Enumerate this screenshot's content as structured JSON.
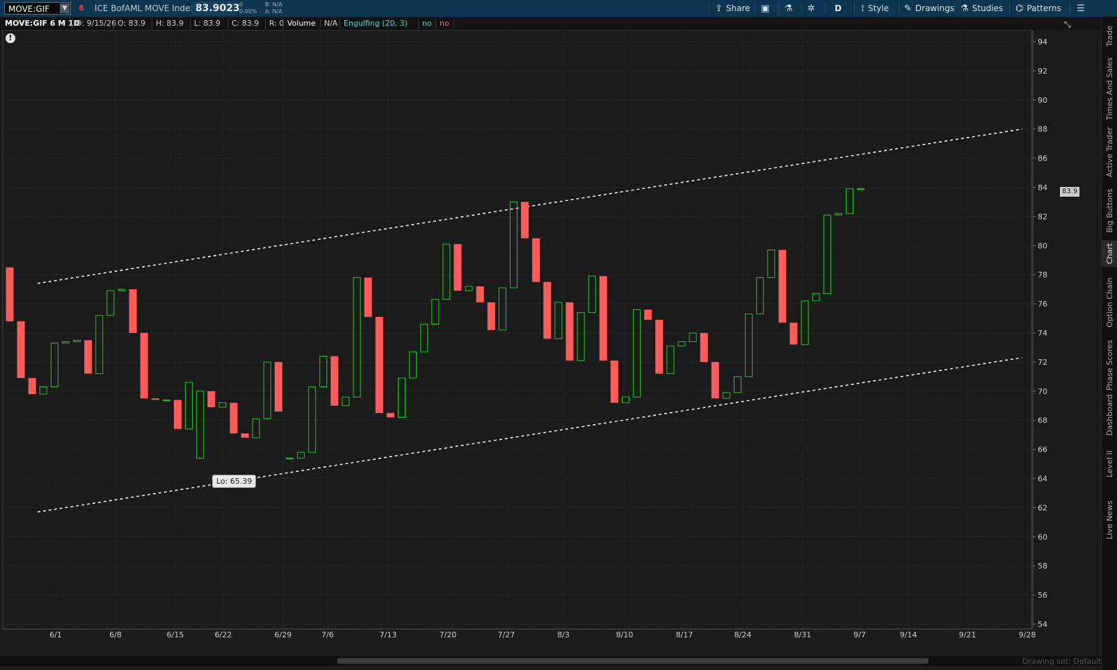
{
  "header": {
    "symbol": "MOVE:GIF",
    "link_flag": "8",
    "instrument_name": "ICE BofAML MOVE Index",
    "last_price": "83.9023",
    "change": "0",
    "change_pct": "0.00%",
    "bid": "B: N/A",
    "ask": "A: N/A"
  },
  "toolbar": {
    "share": "Share",
    "aggregation": "D",
    "style": "Style",
    "drawings": "Drawings",
    "studies": "Studies",
    "patterns": "Patterns"
  },
  "infobar": {
    "title": "MOVE:GIF 6 M 1D",
    "date": "D: 9/15/26",
    "open": "O: 83.9",
    "high": "H: 83.9",
    "low": "L: 83.9",
    "close": "C: 83.9",
    "range": "R: 0",
    "volume_label": "Volume",
    "volume_value": "N/A",
    "study_label": "Engulfing (20, 3)",
    "study_val1": "no",
    "study_val2": "no"
  },
  "annotations": {
    "low_label": "Lo: 65.39",
    "last_price_label": "83.9"
  },
  "side_tabs": [
    "Trade",
    "Times And Sales",
    "Active Trader",
    "Big Buttons",
    "Chart",
    "Option Chain",
    "Phase Scores",
    "Dashboard",
    "Level II",
    "Live News"
  ],
  "active_side_tab": "Chart",
  "footer": {
    "drawing_set": "Drawing set: Default"
  },
  "colors": {
    "up": "#19d01a",
    "down": "#ff5b5b",
    "background": "#1b1b1b",
    "header": "#0b3550"
  },
  "chart_data": {
    "type": "candlestick",
    "title": "MOVE:GIF 6 M 1D",
    "ylim": [
      54,
      95
    ],
    "yticks": [
      54,
      56,
      58,
      60,
      62,
      64,
      66,
      68,
      70,
      72,
      74,
      76,
      78,
      80,
      82,
      84,
      86,
      88,
      90,
      92,
      94
    ],
    "xtick_labels": [
      "6/1",
      "6/8",
      "6/15",
      "6/22",
      "6/29",
      "7/6",
      "7/13",
      "7/20",
      "7/27",
      "8/3",
      "8/10",
      "8/17",
      "8/24",
      "8/31",
      "9/7",
      "9/14",
      "9/21",
      "9/28"
    ],
    "grid": true,
    "candles": [
      {
        "o": 78.5,
        "c": 74.8
      },
      {
        "o": 74.8,
        "c": 70.9
      },
      {
        "o": 70.9,
        "c": 69.8
      },
      {
        "o": 69.8,
        "c": 70.3
      },
      {
        "o": 70.3,
        "c": 73.3
      },
      {
        "o": 73.3,
        "c": 73.4
      },
      {
        "o": 73.4,
        "c": 73.5
      },
      {
        "o": 73.5,
        "c": 71.2
      },
      {
        "o": 71.2,
        "c": 75.2
      },
      {
        "o": 75.2,
        "c": 76.9
      },
      {
        "o": 76.9,
        "c": 77.0
      },
      {
        "o": 77.0,
        "c": 74.0
      },
      {
        "o": 74.0,
        "c": 69.5
      },
      {
        "o": 69.5,
        "c": 69.4
      },
      {
        "o": 69.4,
        "c": 69.4
      },
      {
        "o": 69.4,
        "c": 67.4
      },
      {
        "o": 67.4,
        "c": 70.6
      },
      {
        "o": 65.39,
        "c": 70.0
      },
      {
        "o": 70.0,
        "c": 68.9
      },
      {
        "o": 68.9,
        "c": 69.2
      },
      {
        "o": 69.2,
        "c": 67.1
      },
      {
        "o": 67.1,
        "c": 66.8
      },
      {
        "o": 66.8,
        "c": 68.1
      },
      {
        "o": 68.1,
        "c": 72.0
      },
      {
        "o": 72.0,
        "c": 68.6
      },
      {
        "o": 65.4,
        "c": 65.4
      },
      {
        "o": 65.4,
        "c": 65.8
      },
      {
        "o": 65.8,
        "c": 70.3
      },
      {
        "o": 70.3,
        "c": 72.4
      },
      {
        "o": 72.4,
        "c": 69.0
      },
      {
        "o": 69.0,
        "c": 69.6
      },
      {
        "o": 69.6,
        "c": 77.8
      },
      {
        "o": 77.8,
        "c": 75.1
      },
      {
        "o": 75.1,
        "c": 68.5
      },
      {
        "o": 68.5,
        "c": 68.2
      },
      {
        "o": 68.2,
        "c": 70.9
      },
      {
        "o": 70.9,
        "c": 72.7
      },
      {
        "o": 72.7,
        "c": 74.6
      },
      {
        "o": 74.6,
        "c": 76.3
      },
      {
        "o": 76.3,
        "c": 80.1
      },
      {
        "o": 80.1,
        "c": 76.9
      },
      {
        "o": 76.9,
        "c": 77.2
      },
      {
        "o": 77.2,
        "c": 76.1
      },
      {
        "o": 76.1,
        "c": 74.2
      },
      {
        "o": 74.2,
        "c": 77.1
      },
      {
        "o": 77.1,
        "c": 83.0
      },
      {
        "o": 83.0,
        "c": 80.5
      },
      {
        "o": 80.5,
        "c": 77.5
      },
      {
        "o": 77.5,
        "c": 73.6
      },
      {
        "o": 73.6,
        "c": 76.1
      },
      {
        "o": 76.1,
        "c": 72.1
      },
      {
        "o": 72.1,
        "c": 75.4
      },
      {
        "o": 75.4,
        "c": 77.9
      },
      {
        "o": 77.9,
        "c": 72.1
      },
      {
        "o": 72.1,
        "c": 69.2
      },
      {
        "o": 69.2,
        "c": 69.6
      },
      {
        "o": 69.6,
        "c": 75.6
      },
      {
        "o": 75.6,
        "c": 74.9
      },
      {
        "o": 74.9,
        "c": 71.2
      },
      {
        "o": 71.2,
        "c": 73.1
      },
      {
        "o": 73.1,
        "c": 73.4
      },
      {
        "o": 73.4,
        "c": 74.0
      },
      {
        "o": 74.0,
        "c": 72.0
      },
      {
        "o": 72.0,
        "c": 69.5
      },
      {
        "o": 69.5,
        "c": 69.9
      },
      {
        "o": 69.9,
        "c": 71.0
      },
      {
        "o": 71.0,
        "c": 75.3
      },
      {
        "o": 75.3,
        "c": 77.8
      },
      {
        "o": 77.8,
        "c": 79.7
      },
      {
        "o": 79.7,
        "c": 74.7
      },
      {
        "o": 74.7,
        "c": 73.2
      },
      {
        "o": 73.2,
        "c": 76.2
      },
      {
        "o": 76.2,
        "c": 76.7
      },
      {
        "o": 76.7,
        "c": 82.1
      },
      {
        "o": 82.1,
        "c": 82.2
      },
      {
        "o": 82.2,
        "c": 83.9
      },
      {
        "o": 83.9,
        "c": 83.9
      }
    ],
    "trend_lines": [
      {
        "name": "upper",
        "points": [
          [
            0,
            77.4
          ],
          [
            95,
            88.0
          ]
        ]
      },
      {
        "name": "lower",
        "points": [
          [
            0,
            61.7
          ],
          [
            95,
            72.3
          ]
        ]
      }
    ]
  }
}
